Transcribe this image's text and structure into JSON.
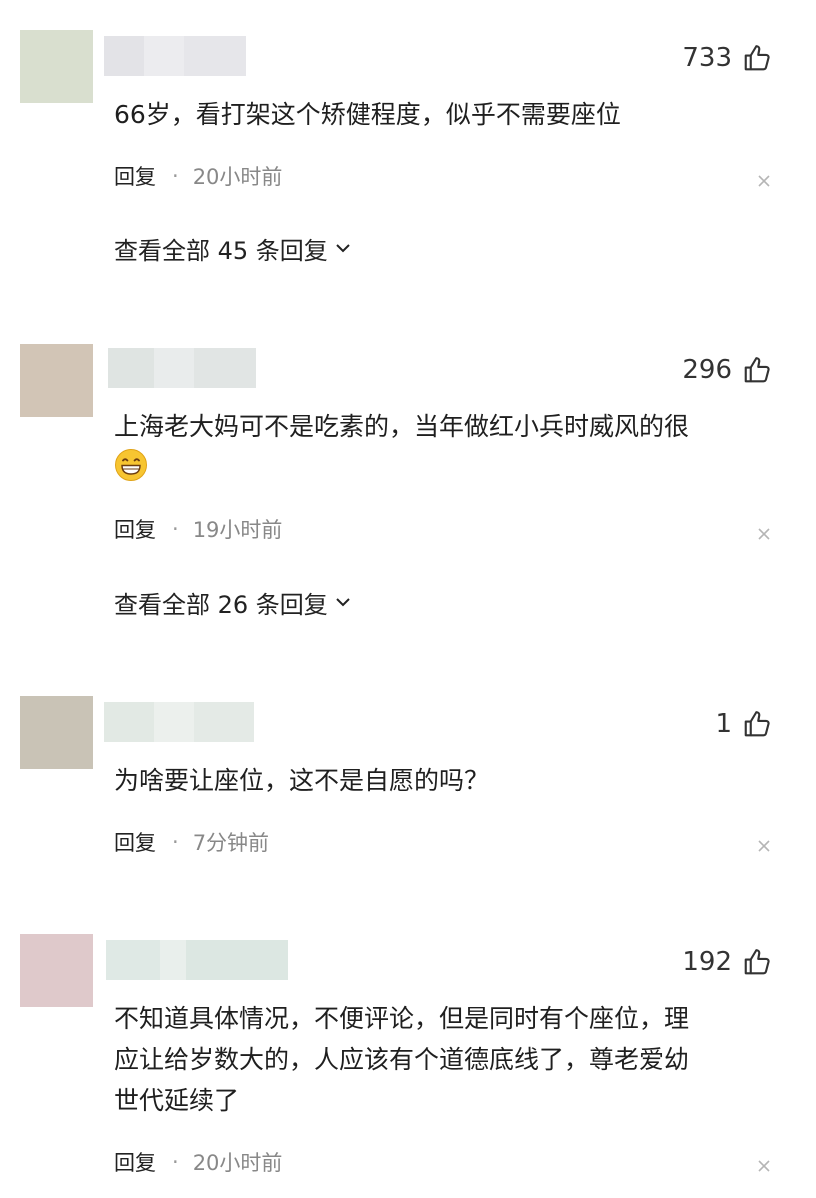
{
  "comments": [
    {
      "likes": "733",
      "text": "66岁，看打架这个矫健程度，似乎不需要座位",
      "reply_label": "回复",
      "separator": "·",
      "time": "20小时前",
      "expand_label": "查看全部 45 条回复",
      "avatar_color": "#d9dfcf",
      "emoji": ""
    },
    {
      "likes": "296",
      "text": "上海老大妈可不是吃素的，当年做红小兵时威风的很",
      "reply_label": "回复",
      "separator": "·",
      "time": "19小时前",
      "expand_label": "查看全部 26 条回复",
      "avatar_color": "#d2c5b6",
      "emoji": "grinning-face"
    },
    {
      "likes": "1",
      "text": "为啥要让座位，这不是自愿的吗？",
      "reply_label": "回复",
      "separator": "·",
      "time": "7分钟前",
      "avatar_color": "#c9c3b6"
    },
    {
      "likes": "192",
      "text": "不知道具体情况，不便评论，但是同时有个座位，理\n应让给岁数大的，人应该有个道德底线了，尊老爱幼\n世代延续了",
      "reply_label": "回复",
      "separator": "·",
      "time": "20小时前",
      "avatar_color": "#dfc9cb"
    }
  ]
}
